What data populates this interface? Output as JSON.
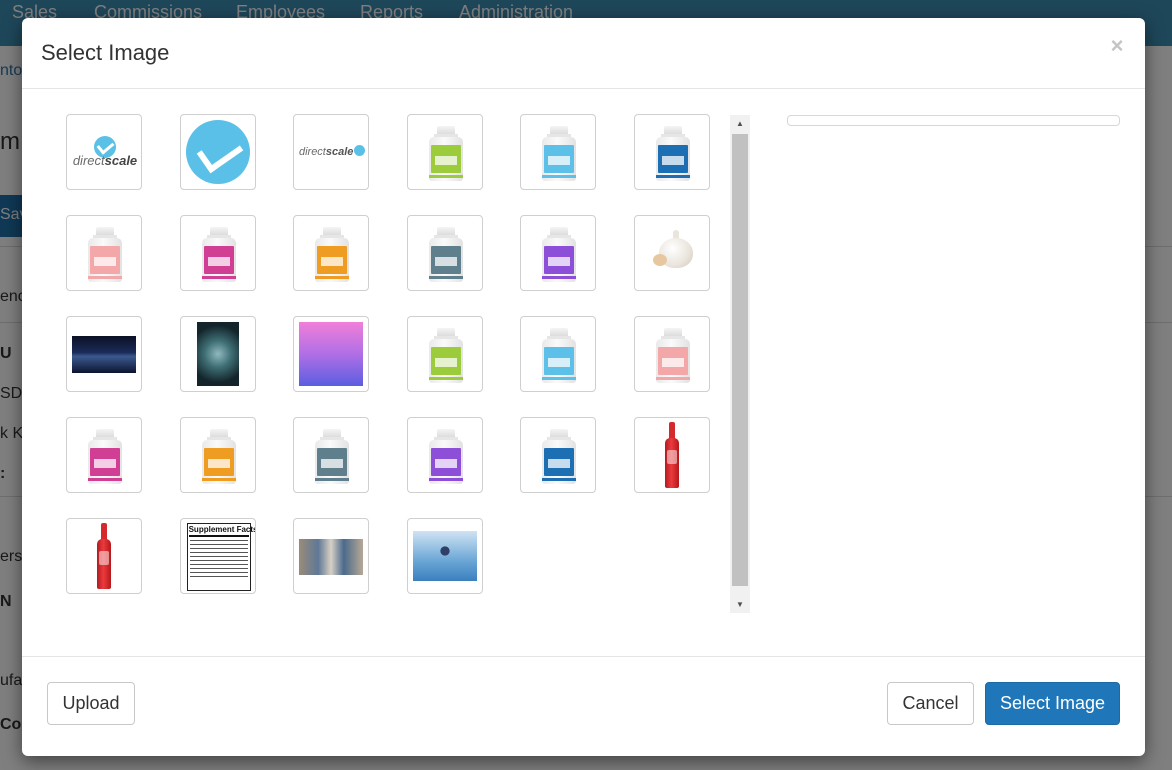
{
  "background": {
    "nav": [
      "Sales",
      "Commissions",
      "Employees",
      "Reports",
      "Administration"
    ],
    "fragments": {
      "crumb": "nto",
      "title_frag": "m",
      "save": "Sav",
      "f1": "enc",
      "f2": "U",
      "f3": "SD",
      "f4": "k K",
      "f5": ":",
      "f6": "ers",
      "f7": "N",
      "f8": "ufa",
      "f9": "Coo"
    },
    "colors": {
      "nav": "#3d8fb5",
      "primary": "#1f76b9"
    }
  },
  "modal": {
    "title": "Select Image",
    "close_symbol": "×",
    "images": [
      {
        "kind": "directscale-logo",
        "text": "direct",
        "text_bold": "scale"
      },
      {
        "kind": "directscale-mark"
      },
      {
        "kind": "directscale-small",
        "text": "direct",
        "text_bold": "scale"
      },
      {
        "kind": "bottle",
        "color": "#9ccc3c"
      },
      {
        "kind": "bottle",
        "color": "#5cc0e8"
      },
      {
        "kind": "bottle",
        "color": "#1c6fb3"
      },
      {
        "kind": "bottle",
        "color": "#f4a7a9"
      },
      {
        "kind": "bottle",
        "color": "#d13f94"
      },
      {
        "kind": "bottle",
        "color": "#ef9c22"
      },
      {
        "kind": "bottle",
        "color": "#5f7f8c"
      },
      {
        "kind": "bottle",
        "color": "#8e4fd8"
      },
      {
        "kind": "garlic"
      },
      {
        "kind": "space-wide"
      },
      {
        "kind": "space-tall"
      },
      {
        "kind": "gradient"
      },
      {
        "kind": "bottle",
        "color": "#9ccc3c"
      },
      {
        "kind": "bottle",
        "color": "#5cc0e8"
      },
      {
        "kind": "bottle",
        "color": "#f4a7a9"
      },
      {
        "kind": "bottle",
        "color": "#d13f94"
      },
      {
        "kind": "bottle",
        "color": "#ef9c22"
      },
      {
        "kind": "bottle",
        "color": "#5f7f8c"
      },
      {
        "kind": "bottle",
        "color": "#8e4fd8"
      },
      {
        "kind": "bottle",
        "color": "#1c6fb3"
      },
      {
        "kind": "wine"
      },
      {
        "kind": "wine"
      },
      {
        "kind": "supplement-facts",
        "text": "Supplement Facts"
      },
      {
        "kind": "photo-people"
      },
      {
        "kind": "photo-celebrate"
      }
    ],
    "buttons": {
      "upload": "Upload",
      "cancel": "Cancel",
      "select": "Select Image"
    }
  }
}
